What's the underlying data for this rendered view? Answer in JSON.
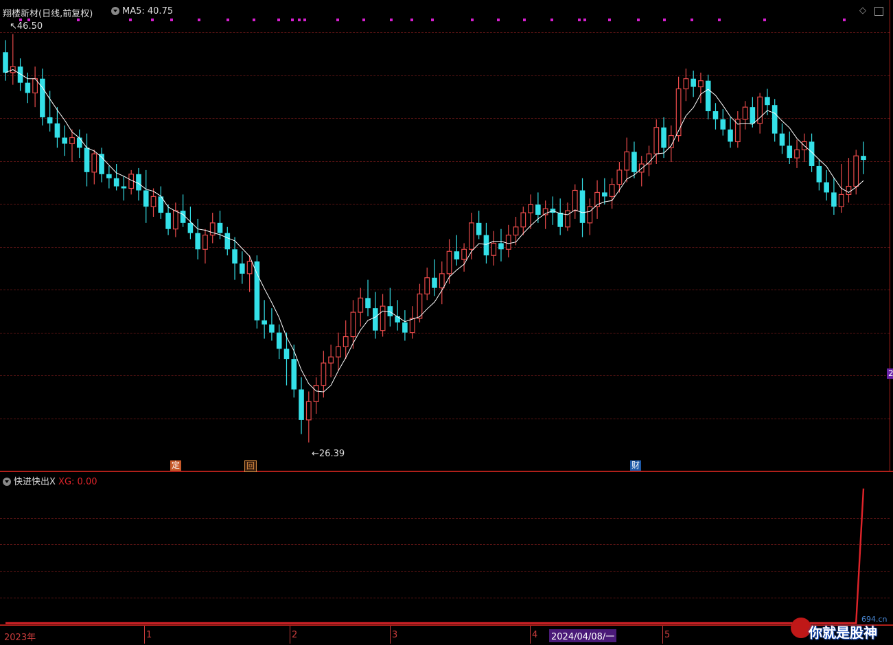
{
  "header": {
    "stock_title": "翔楼新材(日线,前复权)",
    "ma_label": "MA5: 40.75"
  },
  "indicator": {
    "name": "快进快出X",
    "xg_label": "XG: 0.00"
  },
  "annotations": {
    "high_label": "46.50",
    "low_label": "26.39",
    "ding_tag": "定",
    "hui_tag": "回",
    "cai_tag": "财",
    "right_edge_tag": "2"
  },
  "time_axis": {
    "year_label": "2023年",
    "month_1": "1",
    "month_2": "2",
    "month_3": "3",
    "month_4": "4",
    "date_highlight": "2024/04/08/一",
    "month_5": "5"
  },
  "watermark": {
    "site": "694.cn",
    "text": "你就是股神"
  },
  "colors": {
    "up": "#e84a4a",
    "down": "#34e0e8",
    "ma": "#ffffff",
    "grid": "#5a1414",
    "indicator": "#e0242a",
    "marker": "#d71fd0"
  },
  "chart_data": [
    {
      "type": "candlestick",
      "title": "翔楼新材(日线,前复权)",
      "series": [
        {
          "name": "MA5",
          "last_value": 40.75
        }
      ],
      "ylim": [
        25.2,
        47.5
      ],
      "max_label": 46.5,
      "min_label": 26.39,
      "ohlc": [
        [
          45.6,
          46.2,
          44.2,
          44.6
        ],
        [
          44.6,
          46.5,
          44.0,
          44.9
        ],
        [
          44.9,
          45.3,
          43.7,
          44.1
        ],
        [
          44.1,
          44.6,
          43.1,
          43.6
        ],
        [
          43.6,
          44.9,
          42.9,
          44.3
        ],
        [
          44.3,
          44.8,
          42.0,
          42.4
        ],
        [
          42.4,
          43.7,
          41.7,
          42.1
        ],
        [
          42.1,
          42.9,
          40.9,
          41.4
        ],
        [
          41.4,
          42.0,
          40.5,
          41.1
        ],
        [
          41.1,
          41.8,
          40.2,
          41.4
        ],
        [
          41.4,
          41.8,
          40.4,
          40.9
        ],
        [
          40.9,
          41.6,
          39.0,
          39.7
        ],
        [
          39.7,
          40.8,
          39.1,
          40.6
        ],
        [
          40.6,
          40.9,
          39.2,
          39.6
        ],
        [
          39.6,
          40.0,
          38.9,
          39.4
        ],
        [
          39.4,
          40.1,
          38.8,
          39.0
        ],
        [
          39.0,
          39.5,
          38.3,
          38.9
        ],
        [
          38.9,
          39.8,
          38.6,
          39.6
        ],
        [
          39.6,
          39.9,
          38.3,
          38.8
        ],
        [
          38.8,
          39.8,
          37.2,
          38.0
        ],
        [
          38.0,
          38.9,
          37.5,
          38.5
        ],
        [
          38.5,
          39.0,
          37.4,
          37.7
        ],
        [
          37.7,
          38.1,
          36.6,
          36.9
        ],
        [
          36.9,
          38.2,
          36.5,
          37.8
        ],
        [
          37.8,
          38.6,
          37.0,
          37.2
        ],
        [
          37.2,
          38.0,
          36.4,
          36.7
        ],
        [
          36.7,
          37.4,
          35.4,
          35.9
        ],
        [
          35.9,
          36.9,
          35.2,
          36.6
        ],
        [
          36.6,
          37.7,
          36.2,
          37.2
        ],
        [
          37.2,
          37.8,
          36.4,
          36.7
        ],
        [
          36.7,
          37.0,
          35.6,
          35.9
        ],
        [
          35.9,
          36.5,
          34.4,
          35.2
        ],
        [
          35.2,
          35.8,
          34.2,
          34.7
        ],
        [
          34.7,
          35.6,
          33.8,
          35.3
        ],
        [
          35.3,
          35.6,
          32.0,
          32.4
        ],
        [
          32.4,
          33.4,
          31.5,
          32.2
        ],
        [
          32.2,
          33.0,
          31.4,
          31.8
        ],
        [
          31.8,
          32.2,
          30.5,
          31.0
        ],
        [
          31.0,
          31.8,
          29.2,
          30.5
        ],
        [
          30.5,
          31.2,
          28.6,
          29.0
        ],
        [
          29.0,
          29.6,
          26.8,
          27.5
        ],
        [
          27.5,
          28.9,
          26.39,
          28.4
        ],
        [
          28.4,
          29.6,
          27.8,
          29.2
        ],
        [
          29.2,
          30.9,
          28.6,
          30.3
        ],
        [
          30.3,
          31.2,
          29.6,
          30.6
        ],
        [
          30.6,
          31.8,
          29.9,
          31.1
        ],
        [
          31.1,
          32.4,
          30.5,
          31.6
        ],
        [
          31.6,
          33.4,
          31.0,
          32.8
        ],
        [
          32.8,
          34.0,
          32.1,
          33.5
        ],
        [
          33.5,
          34.4,
          32.6,
          33.0
        ],
        [
          33.0,
          33.8,
          31.5,
          31.9
        ],
        [
          31.9,
          33.7,
          31.6,
          33.1
        ],
        [
          33.1,
          34.0,
          32.1,
          32.6
        ],
        [
          32.6,
          33.4,
          31.9,
          32.3
        ],
        [
          32.3,
          32.9,
          31.4,
          31.8
        ],
        [
          31.8,
          33.1,
          31.5,
          32.5
        ],
        [
          32.5,
          34.2,
          32.3,
          33.7
        ],
        [
          33.7,
          35.0,
          33.4,
          34.5
        ],
        [
          34.5,
          35.4,
          33.6,
          34.0
        ],
        [
          34.0,
          35.3,
          33.2,
          34.7
        ],
        [
          34.7,
          36.4,
          34.2,
          35.8
        ],
        [
          35.8,
          36.6,
          35.1,
          35.4
        ],
        [
          35.4,
          36.2,
          34.8,
          35.9
        ],
        [
          35.9,
          37.7,
          35.4,
          37.2
        ],
        [
          37.2,
          37.8,
          36.4,
          36.6
        ],
        [
          36.6,
          37.2,
          35.2,
          35.6
        ],
        [
          35.6,
          36.8,
          35.1,
          36.2
        ],
        [
          36.2,
          36.9,
          35.3,
          35.9
        ],
        [
          35.9,
          37.1,
          35.5,
          36.6
        ],
        [
          36.6,
          37.5,
          36.1,
          37.0
        ],
        [
          37.0,
          38.0,
          36.6,
          37.7
        ],
        [
          37.7,
          38.6,
          36.9,
          38.1
        ],
        [
          38.1,
          38.7,
          37.2,
          37.6
        ],
        [
          37.6,
          38.3,
          36.9,
          37.9
        ],
        [
          37.9,
          38.5,
          37.1,
          37.7
        ],
        [
          37.7,
          38.4,
          36.6,
          37.0
        ],
        [
          37.0,
          38.2,
          36.8,
          37.8
        ],
        [
          37.8,
          39.1,
          37.4,
          38.8
        ],
        [
          38.8,
          39.4,
          36.5,
          37.2
        ],
        [
          37.2,
          38.4,
          36.6,
          38.0
        ],
        [
          38.0,
          39.3,
          37.4,
          38.7
        ],
        [
          38.7,
          39.4,
          38.1,
          38.5
        ],
        [
          38.5,
          39.4,
          37.9,
          39.1
        ],
        [
          39.1,
          40.2,
          38.7,
          39.8
        ],
        [
          39.8,
          41.4,
          39.2,
          40.7
        ],
        [
          40.7,
          41.2,
          39.4,
          39.7
        ],
        [
          39.7,
          40.5,
          39.0,
          40.1
        ],
        [
          40.1,
          41.0,
          39.5,
          40.6
        ],
        [
          40.6,
          42.3,
          40.1,
          41.9
        ],
        [
          41.9,
          42.4,
          40.4,
          40.9
        ],
        [
          40.9,
          42.0,
          40.2,
          41.5
        ],
        [
          41.5,
          44.4,
          41.2,
          43.8
        ],
        [
          43.8,
          44.8,
          43.2,
          44.3
        ],
        [
          44.3,
          44.7,
          43.4,
          43.9
        ],
        [
          43.9,
          44.6,
          43.1,
          44.2
        ],
        [
          44.2,
          44.5,
          42.3,
          42.7
        ],
        [
          42.7,
          43.1,
          41.8,
          42.3
        ],
        [
          42.3,
          42.8,
          41.5,
          41.8
        ],
        [
          41.8,
          42.4,
          40.9,
          41.2
        ],
        [
          41.2,
          42.7,
          40.9,
          42.3
        ],
        [
          42.3,
          43.2,
          41.8,
          42.9
        ],
        [
          42.9,
          43.4,
          41.9,
          42.1
        ],
        [
          42.1,
          43.6,
          41.6,
          43.4
        ],
        [
          43.4,
          43.8,
          42.5,
          43.0
        ],
        [
          43.0,
          43.3,
          41.2,
          41.6
        ],
        [
          41.6,
          42.1,
          40.6,
          41.0
        ],
        [
          41.0,
          41.7,
          40.1,
          40.4
        ],
        [
          40.4,
          41.3,
          39.9,
          40.8
        ],
        [
          40.8,
          41.6,
          40.2,
          41.2
        ],
        [
          41.2,
          41.6,
          39.7,
          40.0
        ],
        [
          40.0,
          40.3,
          38.8,
          39.2
        ],
        [
          39.2,
          39.8,
          38.3,
          38.7
        ],
        [
          38.7,
          39.4,
          37.6,
          38.0
        ],
        [
          38.0,
          40.1,
          37.7,
          38.6
        ],
        [
          38.6,
          40.4,
          38.2,
          39.0
        ],
        [
          39.0,
          40.8,
          38.6,
          40.5
        ],
        [
          40.5,
          41.2,
          39.6,
          40.3
        ]
      ]
    },
    {
      "type": "line",
      "name": "快进快出X",
      "series": [
        {
          "name": "XG",
          "last_value": 0.0
        }
      ],
      "spike_index": 116,
      "spike_value": 1.0
    }
  ]
}
